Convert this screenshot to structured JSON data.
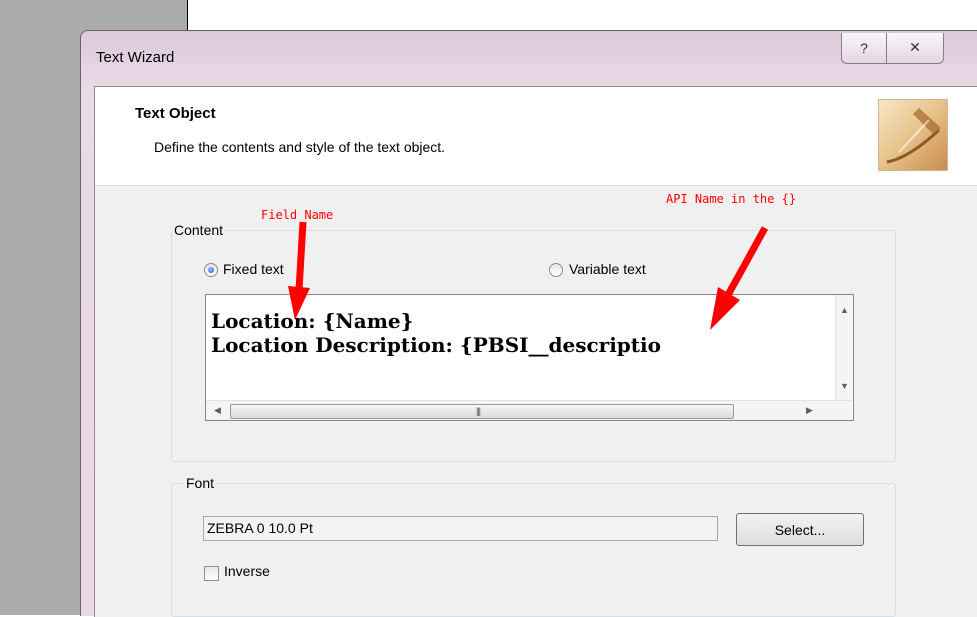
{
  "background_text": "",
  "dialog": {
    "title": "Text Wizard",
    "help_glyph": "?",
    "close_glyph": "✕"
  },
  "header": {
    "title": "Text Object",
    "subtitle": "Define the contents and style of the text object."
  },
  "content_group": {
    "label": "Content",
    "fixed_text_label": "Fixed text",
    "variable_text_label": "Variable text",
    "selected": "Fixed text",
    "text_lines": [
      "Location: {Name}",
      "Location Description: {PBSI__descriptio"
    ]
  },
  "font_group": {
    "label": "Font",
    "font_value": "ZEBRA 0 10.0 Pt",
    "select_label": "Select...",
    "inverse_label": "Inverse",
    "inverse_checked": false
  },
  "annotations": {
    "field_name": "Field Name",
    "api_name": "API Name in the {}"
  },
  "colors": {
    "annotation": "#ff0000",
    "accent": "#1559c0"
  },
  "icons": [
    "help-icon",
    "close-icon",
    "wizard-illustration-icon",
    "scroll-left-icon",
    "scroll-right-icon",
    "scroll-up-icon",
    "scroll-down-icon"
  ]
}
